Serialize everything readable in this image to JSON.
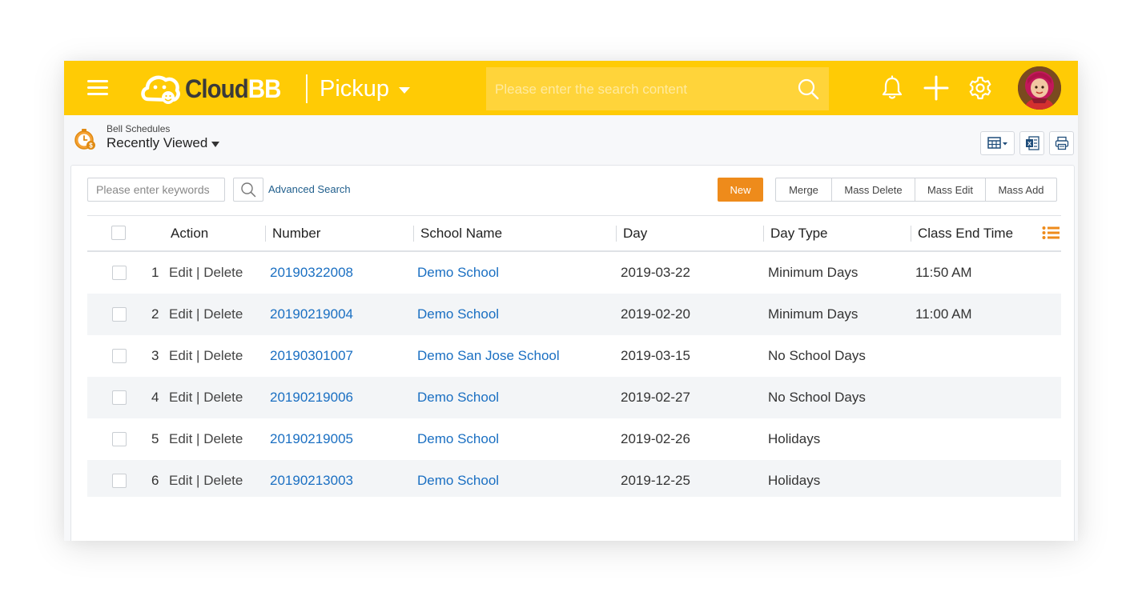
{
  "header": {
    "logo": {
      "text_cloud": "Cloud",
      "text_bb": "BB"
    },
    "module_label": "Pickup",
    "search_placeholder": "Please enter the search content"
  },
  "subheader": {
    "breadcrumb": "Bell Schedules",
    "view_label": "Recently Viewed"
  },
  "toolbar": {
    "keyword_placeholder": "Please enter keywords",
    "advanced_search": "Advanced Search",
    "new_label": "New",
    "merge_label": "Merge",
    "mass_delete_label": "Mass Delete",
    "mass_edit_label": "Mass Edit",
    "mass_add_label": "Mass Add"
  },
  "table": {
    "columns": {
      "action": "Action",
      "number": "Number",
      "school_name": "School Name",
      "day": "Day",
      "day_type": "Day Type",
      "class_end_time": "Class End Time"
    },
    "edit_label": "Edit",
    "delete_label": "Delete",
    "sep": "|",
    "rows": [
      {
        "index": "1",
        "number": "20190322008",
        "school": "Demo School",
        "day": "2019-03-22",
        "day_type": "Minimum Days",
        "end_time": "11:50 AM"
      },
      {
        "index": "2",
        "number": "20190219004",
        "school": "Demo School",
        "day": "2019-02-20",
        "day_type": "Minimum Days",
        "end_time": "11:00 AM"
      },
      {
        "index": "3",
        "number": "20190301007",
        "school": "Demo San Jose School",
        "day": "2019-03-15",
        "day_type": "No School Days",
        "end_time": ""
      },
      {
        "index": "4",
        "number": "20190219006",
        "school": "Demo School",
        "day": "2019-02-27",
        "day_type": "No School Days",
        "end_time": ""
      },
      {
        "index": "5",
        "number": "20190219005",
        "school": "Demo School",
        "day": "2019-02-26",
        "day_type": "Holidays",
        "end_time": ""
      },
      {
        "index": "6",
        "number": "20190213003",
        "school": "Demo School",
        "day": "2019-12-25",
        "day_type": "Holidays",
        "end_time": ""
      }
    ]
  },
  "colors": {
    "brand_yellow": "#ffcb05",
    "accent_orange": "#ee8b1b",
    "link_blue": "#1a6fc2"
  },
  "icons": {
    "menu": "hamburger-icon",
    "search": "search-icon",
    "notifications": "bell-icon",
    "create": "plus-icon",
    "settings": "gear-icon",
    "module": "clock-dollar-icon",
    "table_view": "table-view-icon",
    "export": "excel-icon",
    "print": "printer-icon",
    "columns": "column-list-icon"
  }
}
